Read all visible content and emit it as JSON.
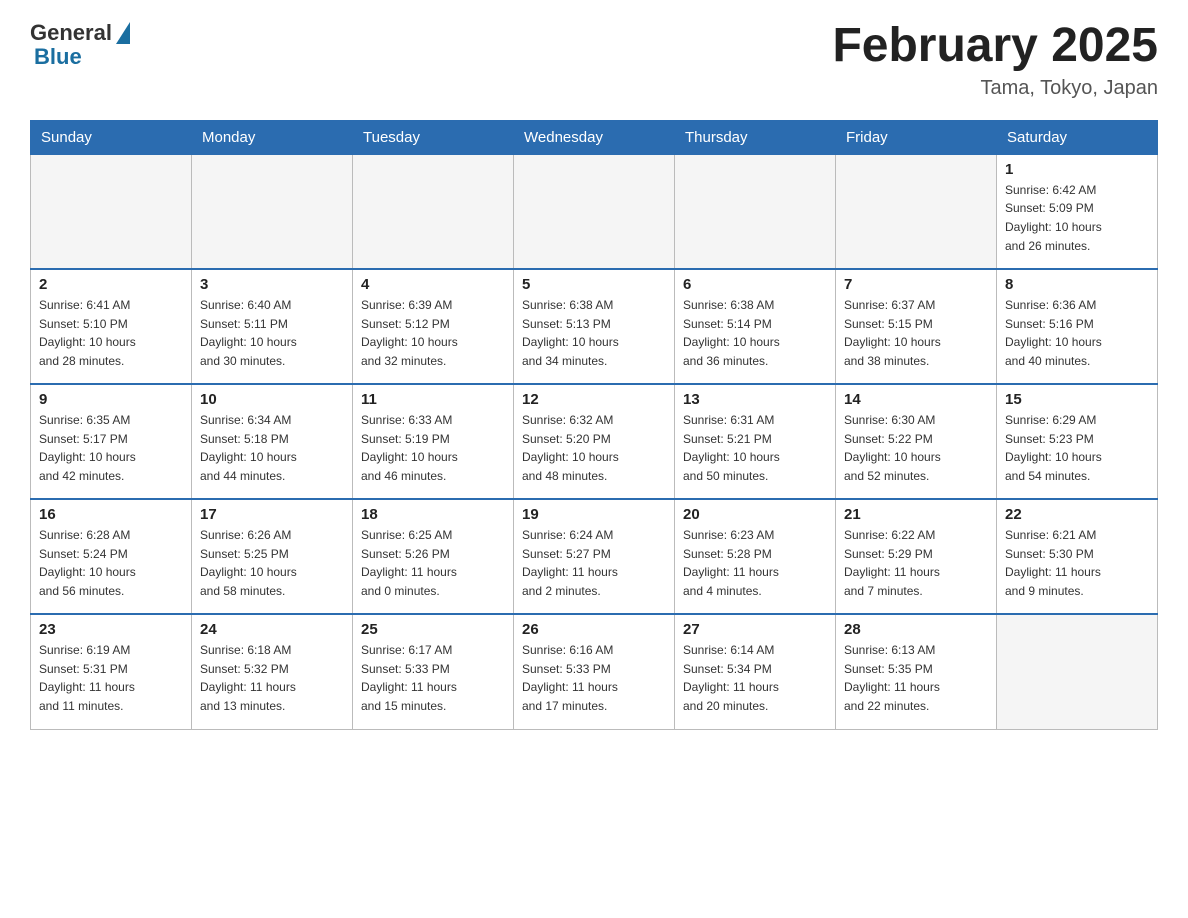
{
  "logo": {
    "general": "General",
    "blue": "Blue"
  },
  "title": "February 2025",
  "subtitle": "Tama, Tokyo, Japan",
  "headers": [
    "Sunday",
    "Monday",
    "Tuesday",
    "Wednesday",
    "Thursday",
    "Friday",
    "Saturday"
  ],
  "weeks": [
    [
      {
        "day": "",
        "info": ""
      },
      {
        "day": "",
        "info": ""
      },
      {
        "day": "",
        "info": ""
      },
      {
        "day": "",
        "info": ""
      },
      {
        "day": "",
        "info": ""
      },
      {
        "day": "",
        "info": ""
      },
      {
        "day": "1",
        "info": "Sunrise: 6:42 AM\nSunset: 5:09 PM\nDaylight: 10 hours\nand 26 minutes."
      }
    ],
    [
      {
        "day": "2",
        "info": "Sunrise: 6:41 AM\nSunset: 5:10 PM\nDaylight: 10 hours\nand 28 minutes."
      },
      {
        "day": "3",
        "info": "Sunrise: 6:40 AM\nSunset: 5:11 PM\nDaylight: 10 hours\nand 30 minutes."
      },
      {
        "day": "4",
        "info": "Sunrise: 6:39 AM\nSunset: 5:12 PM\nDaylight: 10 hours\nand 32 minutes."
      },
      {
        "day": "5",
        "info": "Sunrise: 6:38 AM\nSunset: 5:13 PM\nDaylight: 10 hours\nand 34 minutes."
      },
      {
        "day": "6",
        "info": "Sunrise: 6:38 AM\nSunset: 5:14 PM\nDaylight: 10 hours\nand 36 minutes."
      },
      {
        "day": "7",
        "info": "Sunrise: 6:37 AM\nSunset: 5:15 PM\nDaylight: 10 hours\nand 38 minutes."
      },
      {
        "day": "8",
        "info": "Sunrise: 6:36 AM\nSunset: 5:16 PM\nDaylight: 10 hours\nand 40 minutes."
      }
    ],
    [
      {
        "day": "9",
        "info": "Sunrise: 6:35 AM\nSunset: 5:17 PM\nDaylight: 10 hours\nand 42 minutes."
      },
      {
        "day": "10",
        "info": "Sunrise: 6:34 AM\nSunset: 5:18 PM\nDaylight: 10 hours\nand 44 minutes."
      },
      {
        "day": "11",
        "info": "Sunrise: 6:33 AM\nSunset: 5:19 PM\nDaylight: 10 hours\nand 46 minutes."
      },
      {
        "day": "12",
        "info": "Sunrise: 6:32 AM\nSunset: 5:20 PM\nDaylight: 10 hours\nand 48 minutes."
      },
      {
        "day": "13",
        "info": "Sunrise: 6:31 AM\nSunset: 5:21 PM\nDaylight: 10 hours\nand 50 minutes."
      },
      {
        "day": "14",
        "info": "Sunrise: 6:30 AM\nSunset: 5:22 PM\nDaylight: 10 hours\nand 52 minutes."
      },
      {
        "day": "15",
        "info": "Sunrise: 6:29 AM\nSunset: 5:23 PM\nDaylight: 10 hours\nand 54 minutes."
      }
    ],
    [
      {
        "day": "16",
        "info": "Sunrise: 6:28 AM\nSunset: 5:24 PM\nDaylight: 10 hours\nand 56 minutes."
      },
      {
        "day": "17",
        "info": "Sunrise: 6:26 AM\nSunset: 5:25 PM\nDaylight: 10 hours\nand 58 minutes."
      },
      {
        "day": "18",
        "info": "Sunrise: 6:25 AM\nSunset: 5:26 PM\nDaylight: 11 hours\nand 0 minutes."
      },
      {
        "day": "19",
        "info": "Sunrise: 6:24 AM\nSunset: 5:27 PM\nDaylight: 11 hours\nand 2 minutes."
      },
      {
        "day": "20",
        "info": "Sunrise: 6:23 AM\nSunset: 5:28 PM\nDaylight: 11 hours\nand 4 minutes."
      },
      {
        "day": "21",
        "info": "Sunrise: 6:22 AM\nSunset: 5:29 PM\nDaylight: 11 hours\nand 7 minutes."
      },
      {
        "day": "22",
        "info": "Sunrise: 6:21 AM\nSunset: 5:30 PM\nDaylight: 11 hours\nand 9 minutes."
      }
    ],
    [
      {
        "day": "23",
        "info": "Sunrise: 6:19 AM\nSunset: 5:31 PM\nDaylight: 11 hours\nand 11 minutes."
      },
      {
        "day": "24",
        "info": "Sunrise: 6:18 AM\nSunset: 5:32 PM\nDaylight: 11 hours\nand 13 minutes."
      },
      {
        "day": "25",
        "info": "Sunrise: 6:17 AM\nSunset: 5:33 PM\nDaylight: 11 hours\nand 15 minutes."
      },
      {
        "day": "26",
        "info": "Sunrise: 6:16 AM\nSunset: 5:33 PM\nDaylight: 11 hours\nand 17 minutes."
      },
      {
        "day": "27",
        "info": "Sunrise: 6:14 AM\nSunset: 5:34 PM\nDaylight: 11 hours\nand 20 minutes."
      },
      {
        "day": "28",
        "info": "Sunrise: 6:13 AM\nSunset: 5:35 PM\nDaylight: 11 hours\nand 22 minutes."
      },
      {
        "day": "",
        "info": ""
      }
    ]
  ]
}
